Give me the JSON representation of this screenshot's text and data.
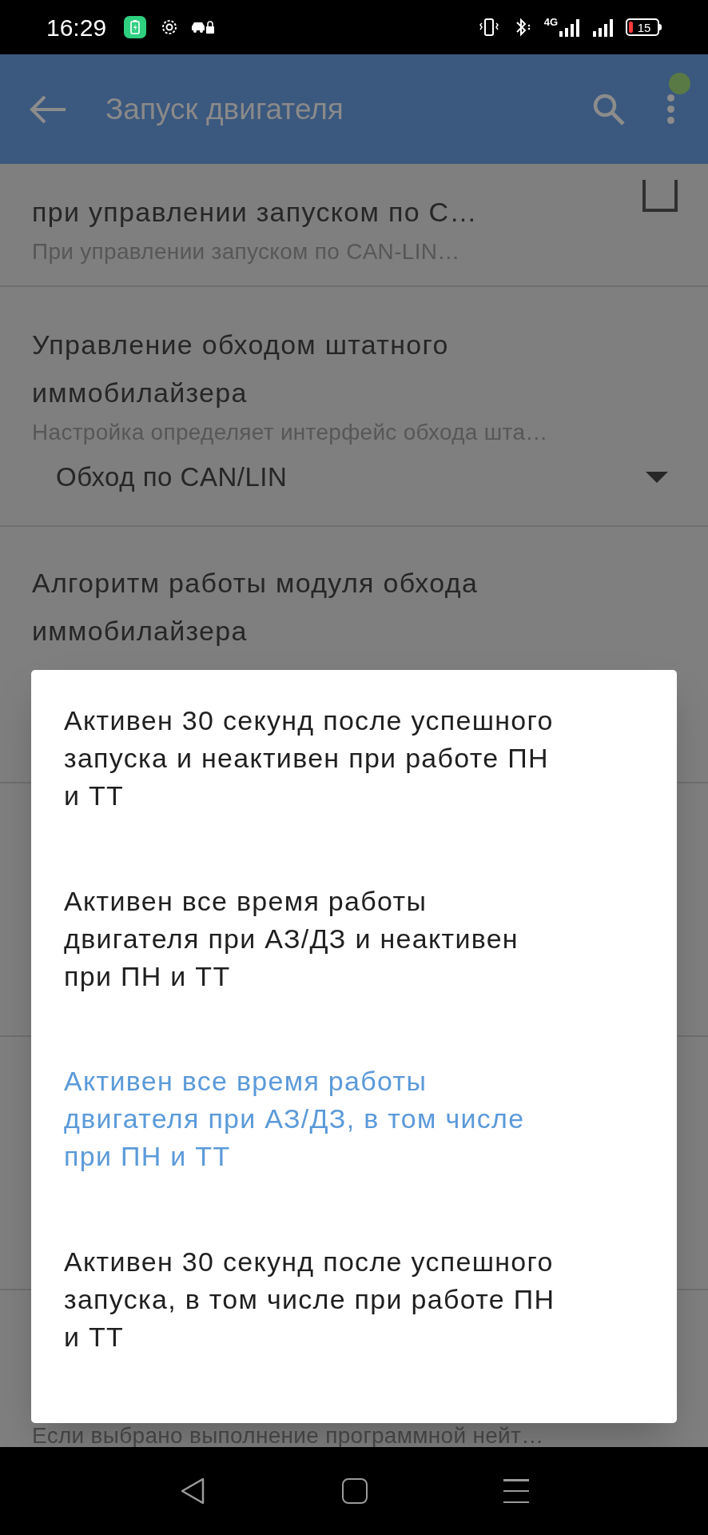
{
  "status_bar": {
    "time": "16:29",
    "network": "4G",
    "battery": "15"
  },
  "app_bar": {
    "title": "Запуск двигателя",
    "notification_dot": true
  },
  "settings": [
    {
      "kind": "checkbox",
      "title": "при управлении запуском по С…",
      "subtitle": "При управлении запуском по CAN-LIN…",
      "checked": false
    },
    {
      "kind": "dropdown",
      "title": "Управление обходом штатного иммобилайзера",
      "subtitle": "Настройка определяет интерфейс обхода шта…",
      "value": "Обход по CAN/LIN"
    },
    {
      "kind": "text",
      "title": "Алгоритм работы модуля обхода иммобилайзера"
    }
  ],
  "hidden_row_subtitle": "Если выбрано выполнение программной нейт…",
  "dialog": {
    "options": [
      {
        "label": "Активен 30 секунд после успешного запуска и неактивен при работе ПН и ТТ",
        "selected": false
      },
      {
        "label": "Активен все время работы двигателя при АЗ/ДЗ и неактивен при ПН и ТТ",
        "selected": false
      },
      {
        "label": "Активен все время работы двигателя при АЗ/ДЗ, в том числе при ПН и ТТ",
        "selected": true
      },
      {
        "label": "Активен 30 секунд после успешного запуска, в том числе при работе ПН и ТТ",
        "selected": false
      }
    ]
  }
}
